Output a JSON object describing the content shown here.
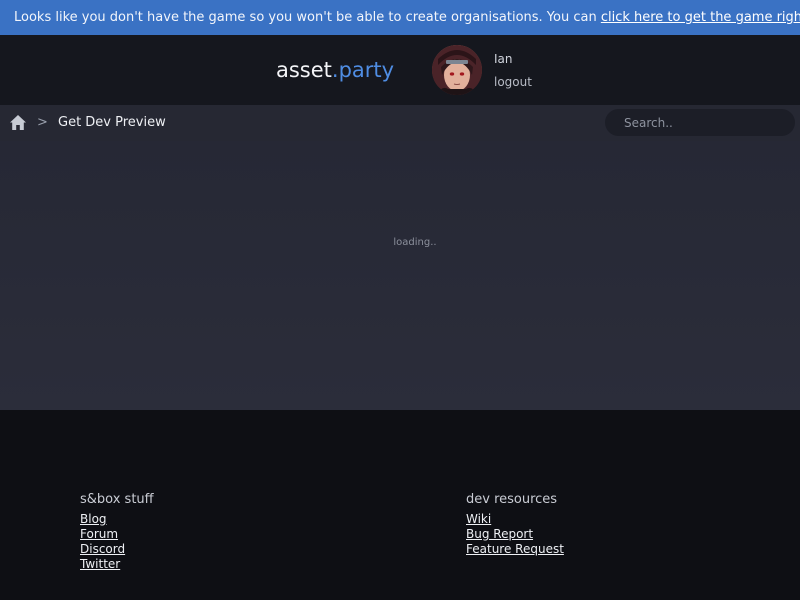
{
  "banner": {
    "text": "Looks like you don't have the game so you won't be able to create organisations. You can ",
    "link": "click here to get the game right now",
    "suffix": "."
  },
  "header": {
    "logo_main": "asset",
    "logo_dot": ".",
    "logo_accent": "party",
    "user_name": "Ian",
    "logout_label": "logout"
  },
  "breadcrumb": {
    "home_icon": "home-icon",
    "separator": ">",
    "current": "Get Dev Preview"
  },
  "search": {
    "placeholder": "Search.."
  },
  "main": {
    "status": "loading.."
  },
  "footer": {
    "columns": [
      {
        "heading": "s&box stuff",
        "links": [
          "Blog",
          "Forum",
          "Discord",
          "Twitter"
        ]
      },
      {
        "heading": "dev resources",
        "links": [
          "Wiki",
          "Bug Report",
          "Feature Request"
        ]
      }
    ]
  },
  "colors": {
    "banner": "#3a72c4",
    "accent": "#4f8de3",
    "topbar": "#15171e",
    "crumbbar": "#262833",
    "main": "#2a2c38",
    "footer": "#0e0f14"
  }
}
